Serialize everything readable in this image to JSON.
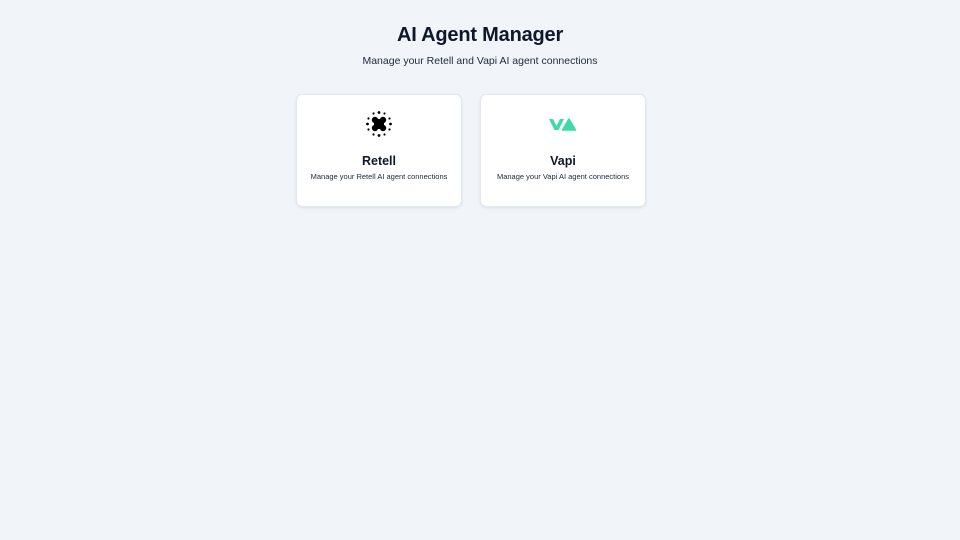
{
  "header": {
    "title": "AI Agent Manager",
    "subtitle": "Manage your Retell and Vapi AI agent connections"
  },
  "cards": [
    {
      "name": "Retell",
      "description": "Manage your Retell AI agent connections",
      "icon": "retell-logo-icon",
      "icon_color": "#000000"
    },
    {
      "name": "Vapi",
      "description": "Manage your Vapi AI agent connections",
      "icon": "vapi-logo-icon",
      "icon_color": "#3ddba5"
    }
  ],
  "colors": {
    "background": "#f1f4f8",
    "card_background": "#ffffff",
    "text": "#0f172a"
  }
}
